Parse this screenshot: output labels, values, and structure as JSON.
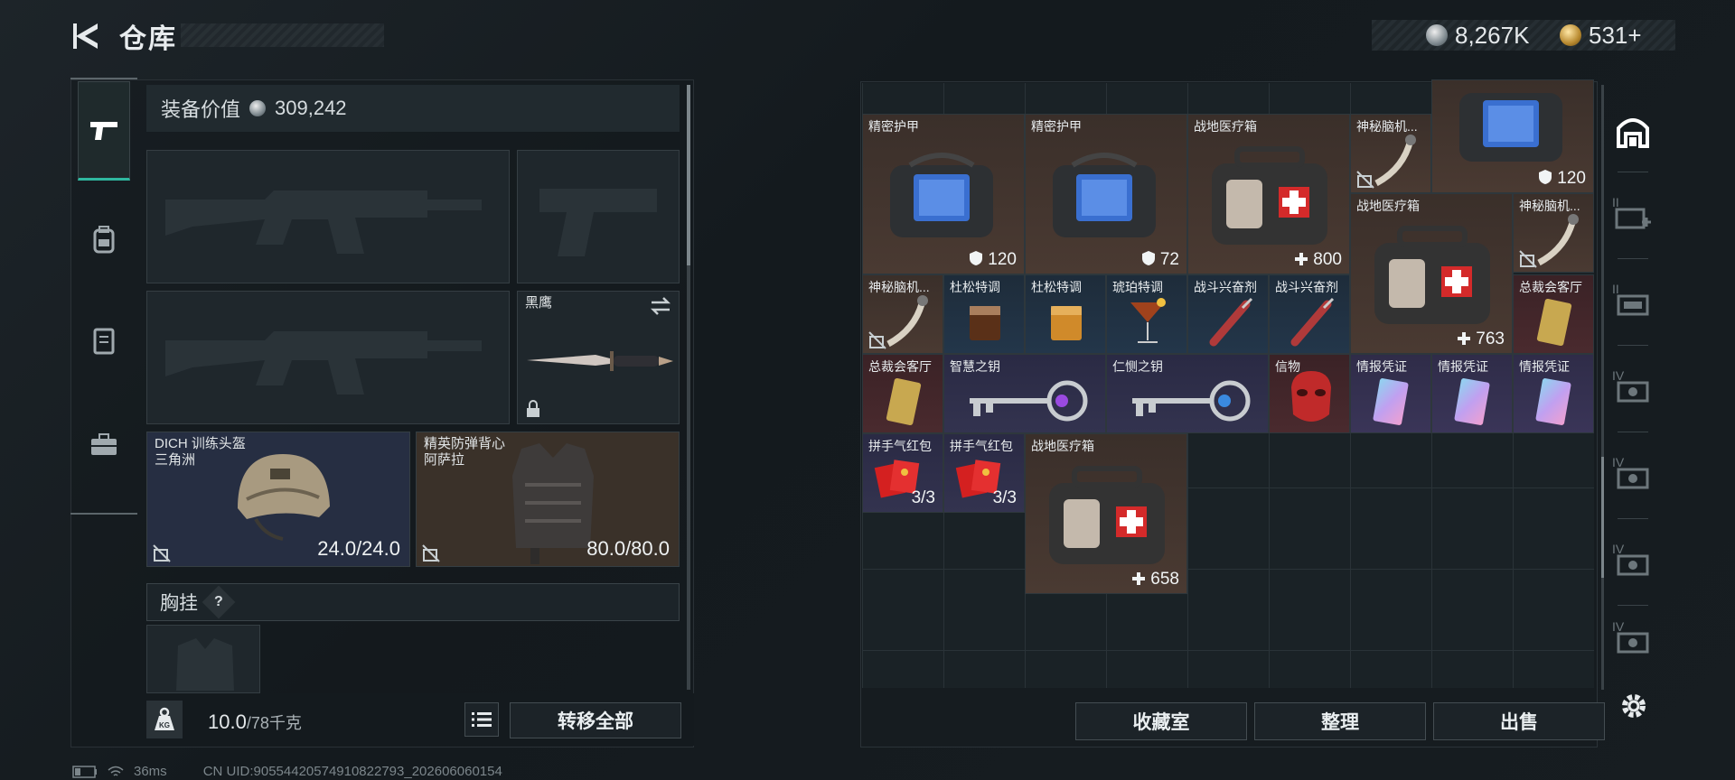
{
  "header": {
    "title": "仓库",
    "currency_silver": "8,267K",
    "currency_gold": "531+"
  },
  "left_panel": {
    "equipment_value_label": "装备价值",
    "equipment_value": "309,242",
    "melee": {
      "name": "黑鹰"
    },
    "helmet": {
      "name": "DICH 训练头盔",
      "sub": "三角洲",
      "durability": "24.0/24.0"
    },
    "armor": {
      "name": "精英防弹背心",
      "sub": "阿萨拉",
      "durability": "80.0/80.0"
    },
    "chest_rig_label": "胸挂",
    "chest_help": "?",
    "weight": "10.0",
    "weight_max": "/78千克",
    "transfer_all": "转移全部",
    "weight_badge": "KG"
  },
  "grid_items": [
    {
      "name": "精密护甲",
      "value": "120"
    },
    {
      "name": "精密护甲",
      "value": "72"
    },
    {
      "name": "战地医疗箱",
      "value": "800"
    },
    {
      "name": "神秘脑机...",
      "value": ""
    },
    {
      "name": "",
      "value": "120"
    },
    {
      "name": "战地医疗箱",
      "value": "763"
    },
    {
      "name": "神秘脑机...",
      "value": ""
    },
    {
      "name": "神秘脑机...",
      "value": ""
    },
    {
      "name": "杜松特调",
      "value": ""
    },
    {
      "name": "杜松特调",
      "value": ""
    },
    {
      "name": "琥珀特调",
      "value": ""
    },
    {
      "name": "战斗兴奋剂",
      "value": ""
    },
    {
      "name": "战斗兴奋剂",
      "value": ""
    },
    {
      "name": "总裁会客厅",
      "value": ""
    },
    {
      "name": "总裁会客厅",
      "value": ""
    },
    {
      "name": "智慧之钥",
      "value": ""
    },
    {
      "name": "仁恻之钥",
      "value": ""
    },
    {
      "name": "信物",
      "value": ""
    },
    {
      "name": "情报凭证",
      "value": ""
    },
    {
      "name": "情报凭证",
      "value": ""
    },
    {
      "name": "情报凭证",
      "value": ""
    },
    {
      "name": "拼手气红包",
      "value": "3/3"
    },
    {
      "name": "拼手气红包",
      "value": "3/3"
    },
    {
      "name": "战地医疗箱",
      "value": "658"
    }
  ],
  "actions": {
    "collection": "收藏室",
    "sort": "整理",
    "sell": "出售"
  },
  "status": {
    "ping": "36ms",
    "uid": "CN UID:90554420574910822793_202606060154"
  },
  "rtab_labels": {
    "t1": "II",
    "t2": "II",
    "t3": "IV",
    "t4": "IV",
    "t5": "IV",
    "t6": "IV"
  },
  "colors": {
    "accent": "#2fb8a0",
    "brown": "#4a3a32",
    "blue": "#23364a",
    "purple": "#33334f",
    "red": "#4a2a2e"
  }
}
